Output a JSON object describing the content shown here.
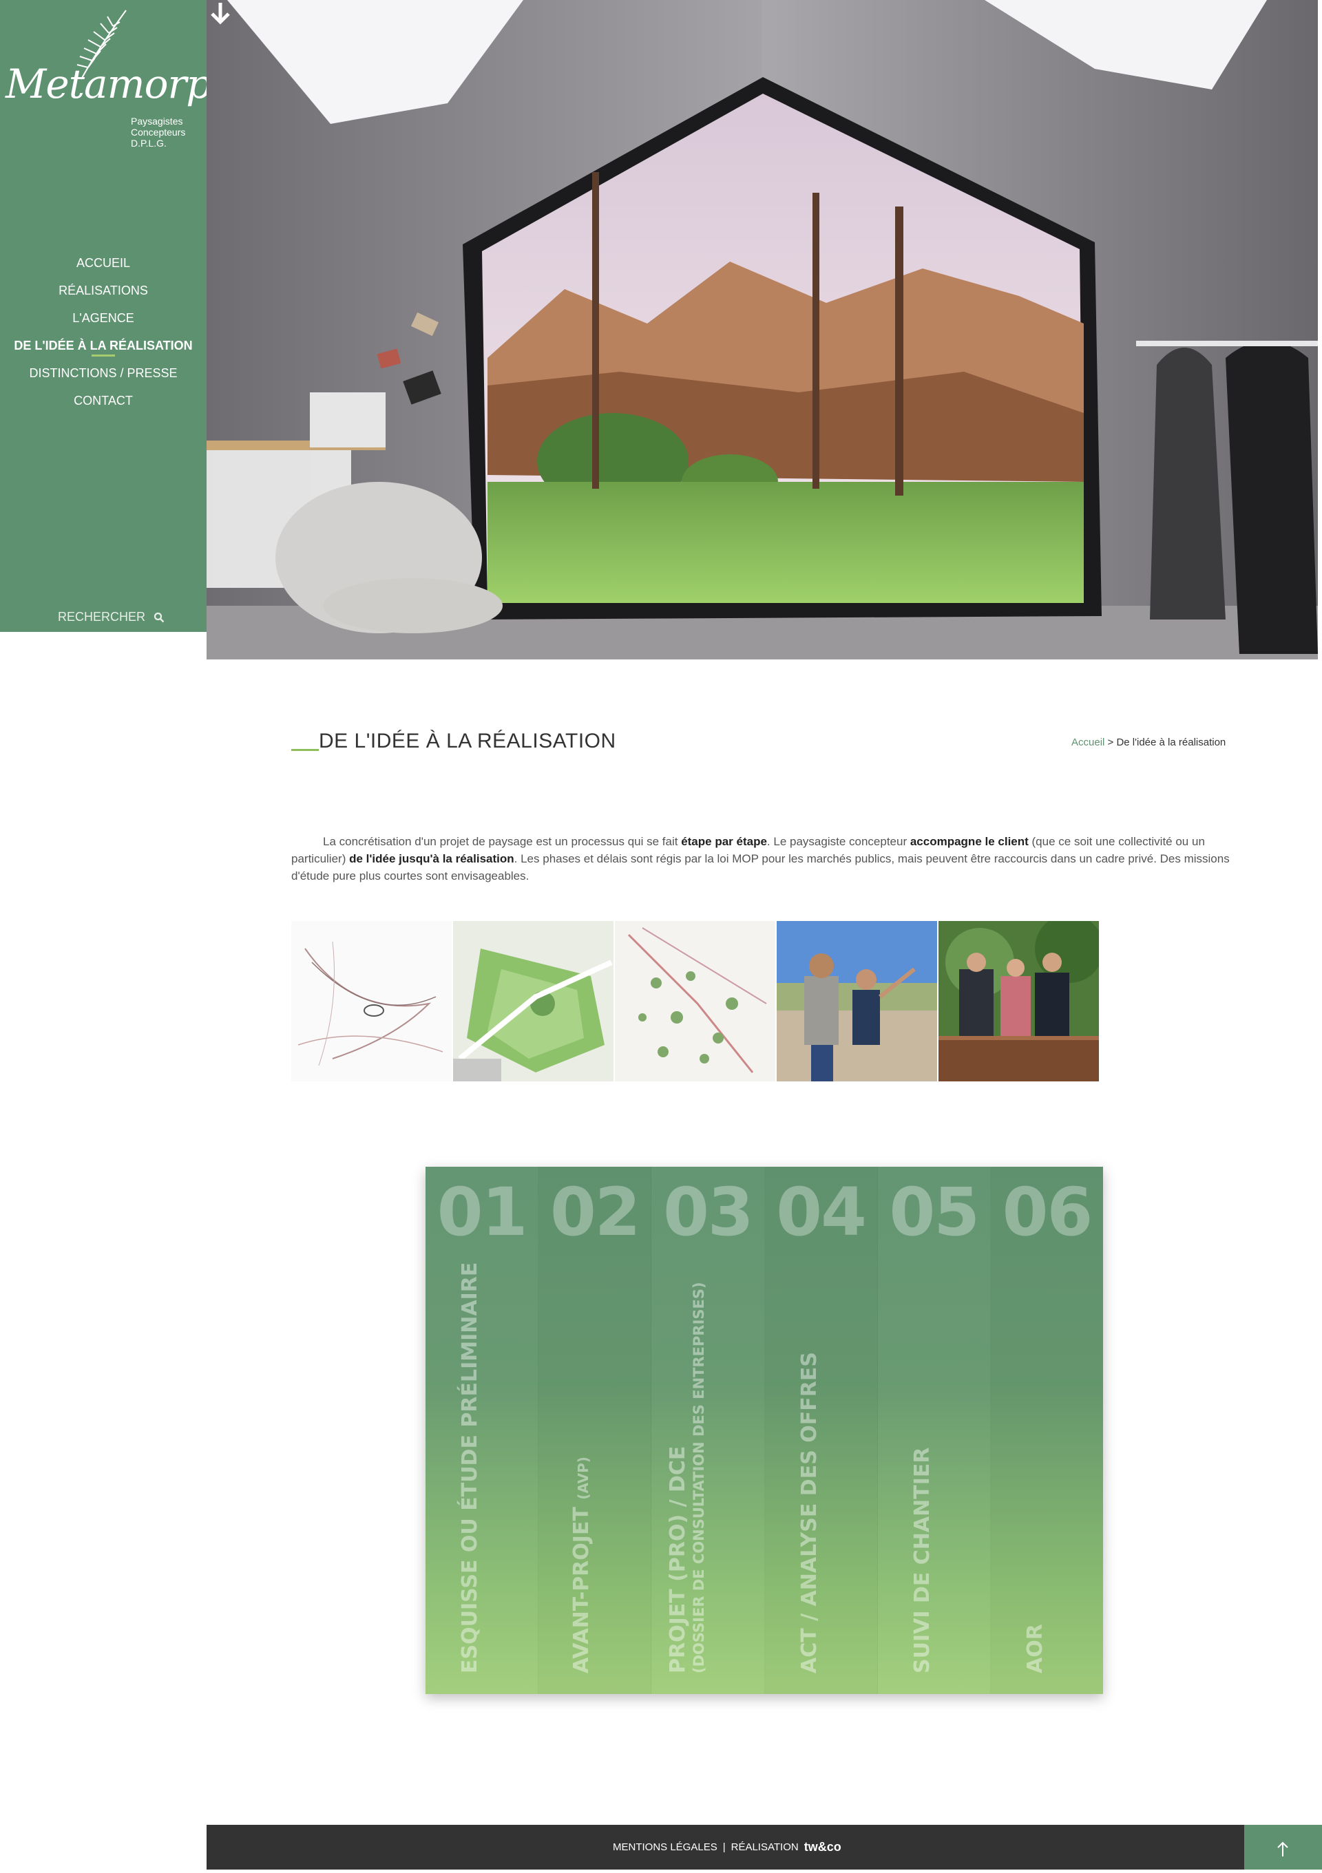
{
  "brand": {
    "name": "Metamorphose",
    "tagline_lines": [
      "Paysagistes",
      "Concepteurs",
      "D.P.L.G."
    ]
  },
  "nav": {
    "items": [
      {
        "label": "ACCUEIL"
      },
      {
        "label": "RÉALISATIONS"
      },
      {
        "label": "L'AGENCE"
      },
      {
        "label": "DE L'IDÉE À LA RÉALISATION",
        "active": true
      },
      {
        "label": "DISTINCTIONS / PRESSE"
      },
      {
        "label": "CONTACT"
      }
    ],
    "search_label": "RECHERCHER"
  },
  "page": {
    "title": "DE L'IDÉE À LA RÉALISATION",
    "breadcrumb": {
      "home": "Accueil",
      "separator": ">",
      "current": "De l'idée à la réalisation"
    }
  },
  "intro": {
    "t1": "La concrétisation d'un projet de paysage est un processus qui se fait ",
    "b1": "étape par étape",
    "t2": ". Le paysagiste concepteur ",
    "b2": "accompagne le client",
    "t3": " (que ce soit une collectivité ou un particulier) ",
    "b3": "de l'idée jusqu'à la réalisation",
    "t4": ". Les phases et délais sont régis par la loi MOP pour les marchés publics, mais peuvent être raccourcis dans un cadre privé. Des missions d'étude pure plus courtes sont envisageables."
  },
  "steps": [
    {
      "num": "01",
      "label": "ESQUISSE OU ÉTUDE PRÉLIMINAIRE",
      "small": "",
      "sub": ""
    },
    {
      "num": "02",
      "label": "AVANT-PROJET ",
      "small": "(AVP)",
      "sub": ""
    },
    {
      "num": "03",
      "label": "PROJET (PRO) / DCE",
      "small": "",
      "sub": "(DOSSIER DE CONSULTATION DES ENTREPRISES)"
    },
    {
      "num": "04",
      "label": "ACT / ANALYSE DES OFFRES",
      "small": "",
      "sub": ""
    },
    {
      "num": "05",
      "label": "SUIVI DE CHANTIER",
      "small": "",
      "sub": ""
    },
    {
      "num": "06",
      "label": "AOR",
      "small": "",
      "sub": ""
    }
  ],
  "footer": {
    "legal": "MENTIONS LÉGALES",
    "separator": "|",
    "realisation": "RÉALISATION",
    "agency": "tw&co"
  },
  "colors": {
    "sidebar": "#5e9170",
    "accent": "#8fbf5a",
    "footer": "#333333"
  }
}
